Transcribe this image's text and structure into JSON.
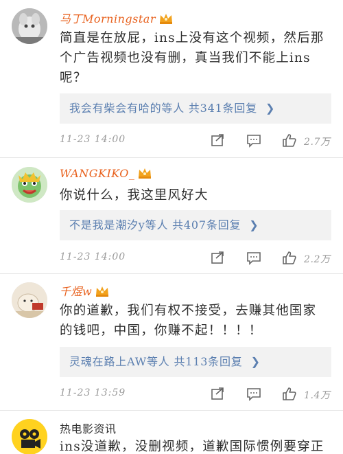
{
  "comments": [
    {
      "username": "马丁Morningstar",
      "text": "简直是在放屁，ins上没有这个视频，然后那个广告视频也没有删，真当我们不能上ins呢？",
      "reply": "我会有柴会有哈的等人 共341条回复",
      "time": "11-23 14:00",
      "likes": "2.7万",
      "name_color": "#e8601c",
      "has_crown": true
    },
    {
      "username": "WANGKIKO_",
      "text": "你说什么，我这里风好大",
      "reply": "不是我是潮汐y等人 共407条回复",
      "time": "11-23 14:00",
      "likes": "2.2万",
      "name_color": "#e8601c",
      "has_crown": true
    },
    {
      "username": "千煜w",
      "text": "你的道歉，我们有权不接受，去赚其他国家的钱吧，中国，你赚不起！！！！",
      "reply": "灵魂在路上AW等人 共113条回复",
      "time": "11-23 13:59",
      "likes": "1.4万",
      "name_color": "#e8601c",
      "has_crown": true
    },
    {
      "username": "热电影资讯",
      "text": "ins没道歉，没删视频，道歉国际惯例要穿正",
      "name_color": "#333333",
      "has_crown": false
    }
  ],
  "icons": {
    "share": "share-icon",
    "comment": "comment-icon",
    "like": "thumbs-up-icon",
    "crown": "crown-icon",
    "reply_arrow": "chevron-right-icon"
  },
  "colors": {
    "link": "#5b7fb0",
    "meta": "#999999",
    "reply_bg": "#f2f2f2",
    "crown": "#f2a21d"
  }
}
